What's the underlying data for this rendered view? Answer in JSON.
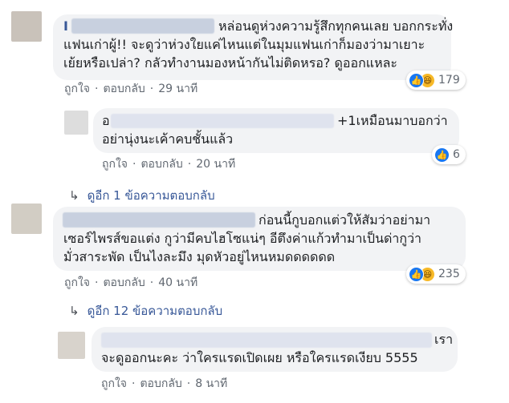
{
  "comments": [
    {
      "name_visible": "I",
      "lines": [
        "หล่อนดูห่วงความรู้สึกทุกคนเลย บอกกระทั่ง",
        "แฟนเก่าผู้!! จะดูว่าห่วงใยแค่ไหนแต่ในมุมแฟนเก่าก็มองว่ามาเยาะ",
        "เย้ยหรือเปล่า? กลัวทำงานมองหน้ากันไม่ติดหรอ? ดูออกแหละ"
      ],
      "like": "ถูกใจ",
      "reply": "ตอบกลับ",
      "time": "29 นาที",
      "reaction_count": "179"
    },
    {
      "lines": [
        "+1เหมือนมาบอกว่า",
        "อย่านุ่งนะเค้าคบชั้นแล้ว"
      ],
      "like": "ถูกใจ",
      "reply": "ตอบกลับ",
      "time": "20 นาที",
      "reaction_count": "6"
    },
    {
      "lines": [
        "ก่อนนี้กูบอกแต่วให้สัมว่าอย่ามา",
        "เซอร์ไพรส์ขอแต่ง กูว่ามีคบไฮโซแน่ๆ อีตึงค่าแก้วทำมาเป็นด่ากูว่า",
        "มั่วสาระพัด เป็นไงละมึง มุดหัวอยู่ไหนหมดดดดดด"
      ],
      "like": "ถูกใจ",
      "reply": "ตอบกลับ",
      "time": "40 นาที",
      "reaction_count": "235"
    },
    {
      "lines": [
        "เรา",
        "จะดูออกนะคะ ว่าใครแรดเปิดเผย หรือใครแรดเงียบ 5555"
      ],
      "like": "ถูกใจ",
      "reply": "ตอบกลับ",
      "time": "8 นาที"
    }
  ],
  "view_replies_1": "ดูอีก 1 ข้อความตอบกลับ",
  "view_replies_2": "ดูอีก 12 ข้อความตอบกลับ",
  "reply_arrow": "↳",
  "comment_2_lead": "อ"
}
